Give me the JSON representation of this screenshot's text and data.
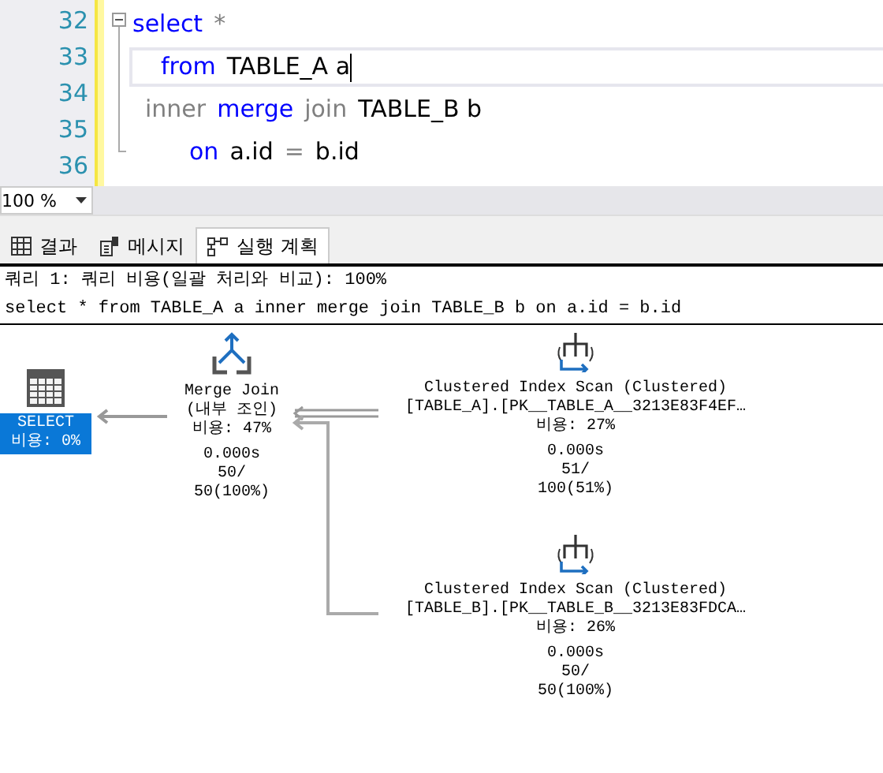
{
  "editor": {
    "lines": [
      {
        "number": "32",
        "current": false,
        "tokens": [
          {
            "text": "select",
            "kind": "keyword"
          },
          {
            "text": "*",
            "kind": "operator"
          }
        ]
      },
      {
        "number": "33",
        "current": true,
        "tokens": [
          {
            "text": "from",
            "kind": "keyword"
          },
          {
            "text": "TABLE_A a",
            "kind": "plain"
          }
        ]
      },
      {
        "number": "34",
        "current": false,
        "tokens": [
          {
            "text": "inner",
            "kind": "operator"
          },
          {
            "text": "merge",
            "kind": "keyword"
          },
          {
            "text": "join",
            "kind": "operator"
          },
          {
            "text": "TABLE_B b",
            "kind": "plain"
          }
        ]
      },
      {
        "number": "35",
        "current": false,
        "tokens": [
          {
            "text": "on",
            "kind": "keyword"
          },
          {
            "text": "a.id",
            "kind": "plain"
          },
          {
            "text": "=",
            "kind": "operator"
          },
          {
            "text": "b.id",
            "kind": "plain"
          }
        ]
      },
      {
        "number": "36",
        "current": false
      }
    ]
  },
  "zoom": {
    "value": "100 %"
  },
  "tabs": [
    {
      "label": "결과",
      "selected": false
    },
    {
      "label": "메시지",
      "selected": false
    },
    {
      "label": "실행 계획",
      "selected": true
    }
  ],
  "plan": {
    "header": "쿼리 1: 쿼리 비용(일괄 처리와 비교): 100%",
    "query": "select * from TABLE_A a inner merge join TABLE_B b on a.id = b.id",
    "nodes": [
      {
        "kind": "select",
        "selected": true,
        "lines": [
          "SELECT",
          "비용: 0%"
        ]
      },
      {
        "kind": "merge",
        "selected": false,
        "lines": [
          "Merge Join",
          "(내부 조인)",
          "비용: 47%",
          "0.000s",
          "50/",
          "50(100%)"
        ]
      },
      {
        "kind": "scan",
        "selected": false,
        "lines": [
          "Clustered Index Scan (Clustered)",
          "[TABLE_A].[PK__TABLE_A__3213E83F4EF…",
          "비용: 27%",
          "0.000s",
          "51/",
          "100(51%)"
        ]
      },
      {
        "kind": "scan",
        "selected": false,
        "lines": [
          "Clustered Index Scan (Clustered)",
          "[TABLE_B].[PK__TABLE_B__3213E83FDCA…",
          "비용: 26%",
          "0.000s",
          "50/",
          "50(100%)"
        ]
      }
    ]
  }
}
